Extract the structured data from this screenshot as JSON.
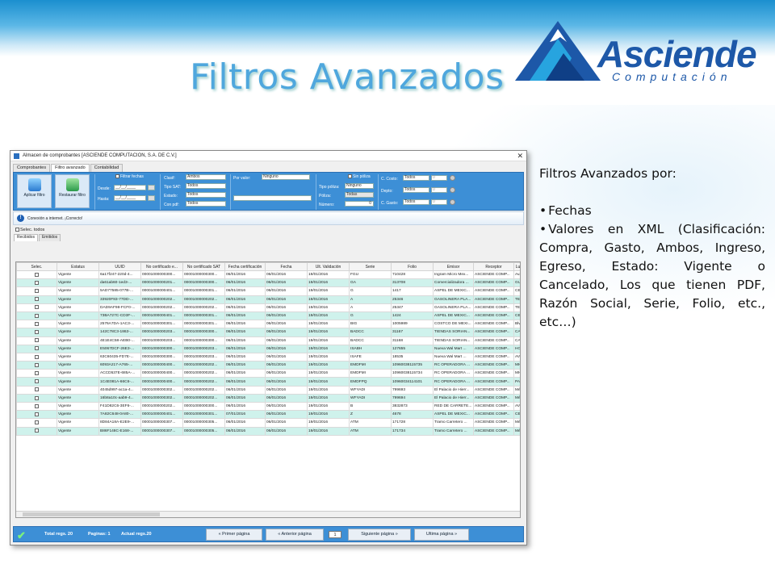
{
  "slide": {
    "title": "Filtros Avanzados",
    "logo_name": "Asciende",
    "logo_sub": "Computación",
    "desc_heading": "Filtros Avanzados por:",
    "bullets": [
      "Fechas",
      "Valores en XML (Clasificación: Compra, Gasto, Ambos, Ingreso, Egreso, Estado: Vigente o Cancelado, Los que tienen PDF, Razón Social, Serie, Folio, etc., etc…)"
    ]
  },
  "window": {
    "title": "Almacen de comprobantes [ASCIENDE COMPUTACION, S.A. DE C.V.]",
    "close": "✕",
    "tabs": [
      "Comprobantes",
      "Filtro avanzado",
      "Contabilidad"
    ],
    "apply_label": "Aplicar filtro",
    "restore_label": "Restaurar filtro",
    "filtrar_fechas": "Filtrar fechas",
    "desde": "Desde:",
    "hasta": "Hasta:",
    "date_mask": "__/__/____",
    "clasif": "Clasif:",
    "clasif_val": "Ambos",
    "tipo_sat": "Tipo SAT:",
    "tipo_sat_val": "Todos",
    "estado": "Estado:",
    "estado_val": "Todos",
    "con_pdf": "Con pdf:",
    "con_pdf_val": "Todos",
    "por_valor": "Por valor:",
    "por_valor_val": "Ninguno",
    "sin_poliza": "Sin póliza",
    "tipo_poliza": "Tipo póliza:",
    "tipo_poliza_val": "Ninguno",
    "poliza": "Póliza:",
    "poliza_val": "Todas",
    "numero": "Número:",
    "numero_val": "0",
    "c_costo": "C. Costo:",
    "depto": "Depto:",
    "c_gasto": "C. Gasto:",
    "todos": "Todos",
    "zero": "0",
    "status": "Conexión a internet. ¡Correcto!",
    "sel_todos": "Selec. todos",
    "subtabs": [
      "Recibidos",
      "Emitidos"
    ],
    "columns": [
      "Selec.",
      "Estatus",
      "UUID",
      "No certificado e...",
      "No certificado SAT",
      "Fecha certificación",
      "Fecha",
      "Ult. Validación",
      "Serie",
      "Folio",
      "Emisor",
      "Receptor",
      "Lu"
    ],
    "rows": [
      [
        "Vigente",
        "6a17f247-220d-4...",
        "00001000000300...",
        "00001000000300...",
        "06/01/2016",
        "06/01/2016",
        "19/01/2016",
        "FGU",
        "710428",
        "Ingram Micro Mex...",
        "ASCIENDE COMP...",
        "Av..."
      ],
      [
        "Vigente",
        "da61ab60-1ed3-...",
        "00001000000201...",
        "00001000000300...",
        "06/01/2016",
        "06/01/2016",
        "19/01/2016",
        "GA",
        "313708",
        "Comercializadora ...",
        "ASCIENDE COMP...",
        "GUA"
      ],
      [
        "Vigente",
        "5AD77585-077B-...",
        "00001000000401...",
        "00001000000301...",
        "06/01/2016",
        "06/01/2016",
        "19/01/2016",
        "G",
        "1417",
        "ASPEL DE MEXIC...",
        "ASCIENDE COMP...",
        "CER"
      ],
      [
        "Vigente",
        "33920F83-77DD-...",
        "00001000000202...",
        "00001000000202...",
        "06/01/2016",
        "06/01/2016",
        "19/01/2016",
        "A",
        "25346",
        "GASOLINERA PLA...",
        "ASCIENDE COMP...",
        "TEN"
      ],
      [
        "Vigente",
        "DAD9AF98-FCF0-...",
        "00001000000202...",
        "00001000000202...",
        "06/01/2016",
        "06/01/2016",
        "19/01/2016",
        "A",
        "25347",
        "GASOLINERA PLA...",
        "ASCIENDE COMP...",
        "TEN"
      ],
      [
        "Vigente",
        "73BA727C-CD3F-...",
        "00001000000401...",
        "00001000000301...",
        "06/01/2016",
        "06/01/2016",
        "19/01/2016",
        "G",
        "1424",
        "ASPEL DE MEXIC...",
        "ASCIENDE COMP...",
        "CER"
      ],
      [
        "Vigente",
        "2576A7DA-1AC3-...",
        "00001000000301...",
        "00001000000301...",
        "06/01/2016",
        "06/01/2016",
        "19/01/2016",
        "BIG",
        "1005989",
        "COSTCO DE MEXI...",
        "ASCIENDE COMP...",
        "Blvd"
      ],
      [
        "Vigente",
        "142C78C3-1863-...",
        "00001000000203...",
        "00001000000300...",
        "06/01/2016",
        "06/01/2016",
        "19/01/2016",
        "BADCC",
        "31167",
        "TIENDAS SORIAN...",
        "ASCIENDE COMP...",
        "CAR"
      ],
      [
        "Vigente",
        "4E1E4C58-AEB0-...",
        "00001000000203...",
        "00001000000300...",
        "06/01/2016",
        "06/01/2016",
        "19/01/2016",
        "BADCC",
        "31168",
        "TIENDAS SORIAN...",
        "ASCIENDE COMP...",
        "CAR"
      ],
      [
        "Vigente",
        "E5067DCF-26E3-...",
        "00001000000300...",
        "00001000000203...",
        "06/01/2016",
        "06/01/2016",
        "19/01/2016",
        "ISABH",
        "127655",
        "Nueva Wal Mart ...",
        "ASCIENDE COMP...",
        "HOR"
      ],
      [
        "Vigente",
        "63C60435-FD7E-...",
        "00001000000300...",
        "00001000000203...",
        "06/01/2016",
        "06/01/2016",
        "19/01/2016",
        "ISAFE",
        "18535",
        "Nueva Wal Mart ...",
        "ASCIENDE COMP...",
        "AV L"
      ],
      [
        "Vigente",
        "6093A217-A765-...",
        "00001000000400...",
        "00001000000202...",
        "06/01/2016",
        "06/01/2016",
        "19/01/2016",
        "EMDFMI",
        "10960038115735",
        "RC OPERADORA ...",
        "ASCIENDE COMP...",
        "MIC"
      ],
      [
        "Vigente",
        "ACCD537E-685A-...",
        "00001000000400...",
        "00001000000202...",
        "06/01/2016",
        "06/01/2016",
        "19/01/2016",
        "EMDFMI",
        "10960038115734",
        "RC OPERADORA ...",
        "ASCIENDE COMP...",
        "MIC"
      ],
      [
        "Vigente",
        "1C4E081A-66C6-...",
        "00001000000400...",
        "00001000000202...",
        "06/01/2016",
        "06/01/2016",
        "19/01/2016",
        "EMDFPQ",
        "10960034114101",
        "RC OPERADORA ...",
        "ASCIENDE COMP...",
        "PAR"
      ],
      [
        "Vigente",
        "4045d997-ac1a-4...",
        "00001000000302...",
        "00001000000202...",
        "06/01/2016",
        "06/01/2016",
        "19/01/2016",
        "WFYADI",
        "799693",
        "El Palacio de Hierr...",
        "ASCIENDE COMP...",
        "Méx"
      ],
      [
        "Vigente",
        "16b8a10c-aab9-4...",
        "00001000000302...",
        "00001000000202...",
        "06/01/2016",
        "06/01/2016",
        "19/01/2016",
        "WFYADI",
        "799694",
        "El Palacio de Hierr...",
        "ASCIENDE COMP...",
        "Méx"
      ],
      [
        "Vigente",
        "F41D82C6-3EF6-...",
        "00001000000202...",
        "00001000000300...",
        "06/01/2016",
        "06/01/2016",
        "19/01/2016",
        "B",
        "3832873",
        "RED DE CARRETE...",
        "ASCIENDE COMP...",
        "AVEI"
      ],
      [
        "Vigente",
        "7A82C648-0A80-...",
        "00001000000401...",
        "00001000000301...",
        "07/01/2016",
        "06/01/2016",
        "19/01/2016",
        "Z",
        "4678",
        "ASPEL DE MEXIC...",
        "ASCIENDE COMP...",
        "CER"
      ],
      [
        "Vigente",
        "8D84A18A-E2E9-...",
        "00001000000307...",
        "00001000000305...",
        "06/01/2016",
        "06/01/2016",
        "19/01/2016",
        "ATM",
        "171728",
        "Tramo Carretero ...",
        "ASCIENDE COMP...",
        "Méx"
      ],
      [
        "Vigente",
        "B86F148C-E168-...",
        "00001000000307...",
        "00001000000305...",
        "06/01/2016",
        "06/01/2016",
        "19/01/2016",
        "ATM",
        "171734",
        "Tramo Carretero ...",
        "ASCIENDE COMP...",
        "Méx"
      ]
    ],
    "footer": {
      "total": "Total regs. 20",
      "paginas": "Paginas: 1",
      "actual": "Actual regs.20",
      "first": "Primer página",
      "prev": "Anterior página",
      "page": "1",
      "next": "Siguiente página",
      "last": "Ultima página"
    }
  }
}
